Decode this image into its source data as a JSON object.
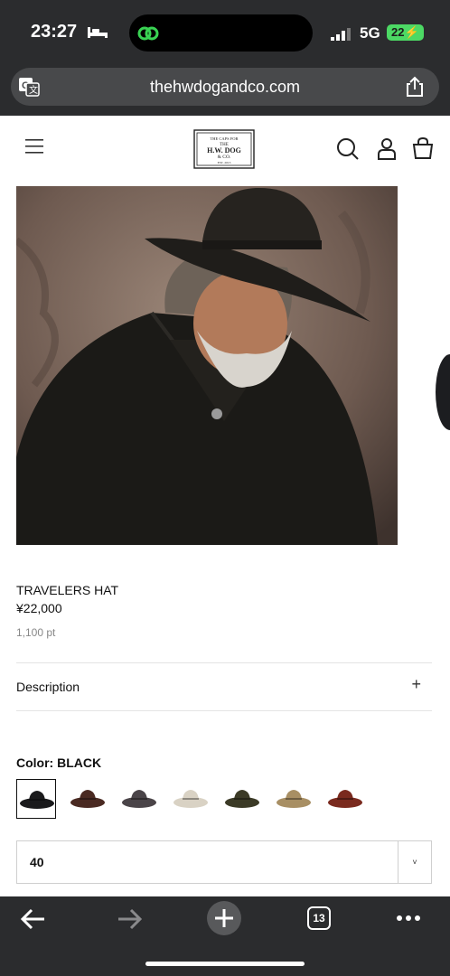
{
  "status_bar": {
    "time": "23:27",
    "network": "5G",
    "battery": "22"
  },
  "browser": {
    "url": "thehwdogandco.com",
    "tab_count": "13"
  },
  "site": {
    "logo_lines": [
      "THE CAPS FOR",
      "THE",
      "H.W. DOG",
      "& CO.",
      "EST. 2013"
    ]
  },
  "product": {
    "title": "TRAVELERS HAT",
    "price": "¥22,000",
    "points": "1,100 pt",
    "description_label": "Description",
    "color_label": "Color: BLACK",
    "swatches": [
      {
        "name": "black",
        "color": "#1a1a1c"
      },
      {
        "name": "brown",
        "color": "#4a2a22"
      },
      {
        "name": "charcoal",
        "color": "#4a4448"
      },
      {
        "name": "ivory",
        "color": "#d9d2c4"
      },
      {
        "name": "olive",
        "color": "#3b3a26"
      },
      {
        "name": "tan",
        "color": "#a88f64"
      },
      {
        "name": "red",
        "color": "#7a2a1e"
      }
    ],
    "size_value": "40"
  },
  "colors": {
    "chrome": "#2b2c2e",
    "url_field": "#48494b",
    "battery": "#4cd964"
  }
}
